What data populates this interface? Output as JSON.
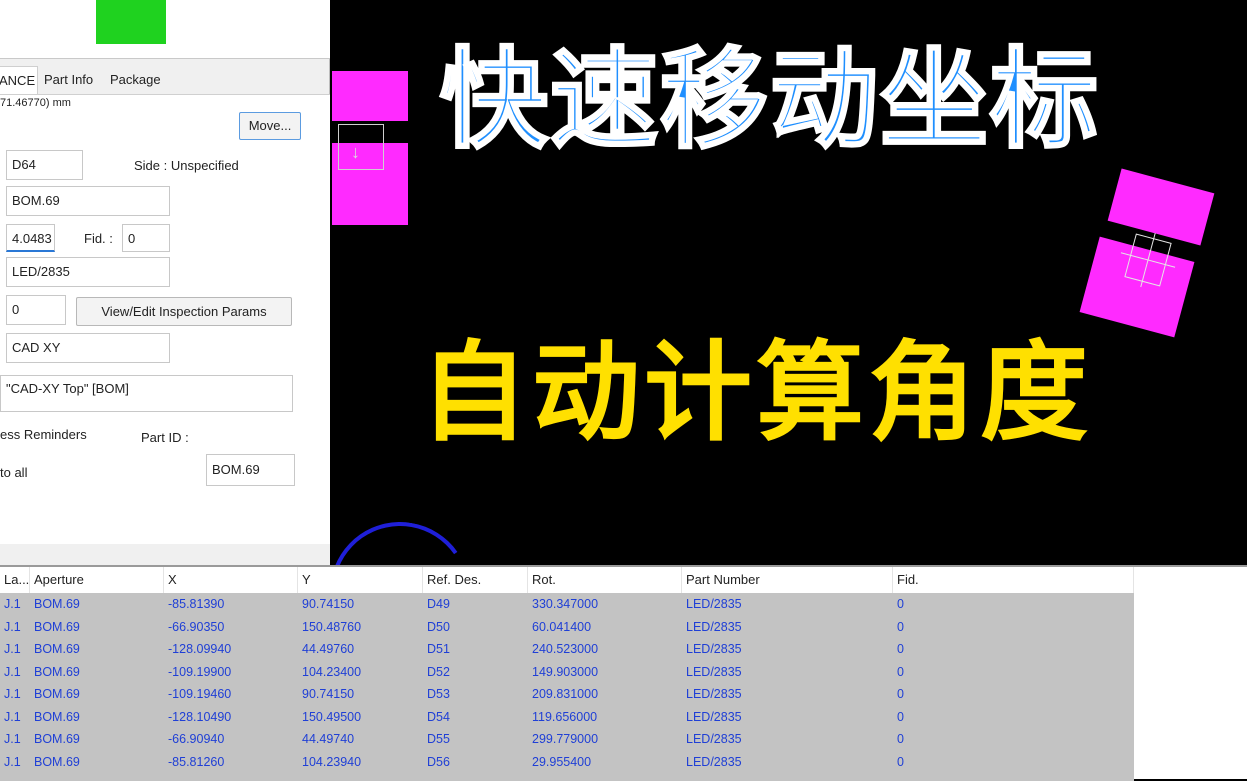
{
  "headline": {
    "line1": "快速移动坐标",
    "line2": "自动计算角度",
    "line1_color": "#1f8fff",
    "line2_color": "#ffe000"
  },
  "canvas": {
    "pad_color": "#ff2aff",
    "arc_color": "#1f1fd8",
    "selection_arrow": "↓"
  },
  "panel": {
    "swatch_color": "#1fd21f",
    "tabs": [
      "ANCE",
      "Part Info",
      "Package"
    ],
    "coord_text": "71.46770) mm",
    "move_button": "Move...",
    "ref_des_value": "D64",
    "side_label": "Side : Unspecified",
    "aperture_value": "BOM.69",
    "rotation_value": "4.0483",
    "fid_label": "Fid. :",
    "fid_value": "0",
    "part_number_value": "LED/2835",
    "inspection_value": "0",
    "view_edit_button": "View/Edit Inspection Params",
    "source_value": "CAD XY",
    "layer_value": "\"CAD-XY Top\" [BOM]",
    "reminders_label": "ess Reminders",
    "part_id_label": "Part ID :",
    "to_all_label": "to all",
    "part_id_value": "BOM.69"
  },
  "table": {
    "headers": [
      "La...",
      "Aperture",
      "X",
      "Y",
      "Ref. Des.",
      "Rot.",
      "Part Number",
      "Fid."
    ],
    "rows": [
      [
        "J.1",
        "BOM.69",
        "-85.81390",
        "90.74150",
        "D49",
        "330.347000",
        "LED/2835",
        "0"
      ],
      [
        "J.1",
        "BOM.69",
        "-66.90350",
        "150.48760",
        "D50",
        "60.041400",
        "LED/2835",
        "0"
      ],
      [
        "J.1",
        "BOM.69",
        "-128.09940",
        "44.49760",
        "D51",
        "240.523000",
        "LED/2835",
        "0"
      ],
      [
        "J.1",
        "BOM.69",
        "-109.19900",
        "104.23400",
        "D52",
        "149.903000",
        "LED/2835",
        "0"
      ],
      [
        "J.1",
        "BOM.69",
        "-109.19460",
        "90.74150",
        "D53",
        "209.831000",
        "LED/2835",
        "0"
      ],
      [
        "J.1",
        "BOM.69",
        "-128.10490",
        "150.49500",
        "D54",
        "119.656000",
        "LED/2835",
        "0"
      ],
      [
        "J.1",
        "BOM.69",
        "-66.90940",
        "44.49740",
        "D55",
        "299.779000",
        "LED/2835",
        "0"
      ],
      [
        "J.1",
        "BOM.69",
        "-85.81260",
        "104.23940",
        "D56",
        "29.955400",
        "LED/2835",
        "0"
      ]
    ]
  }
}
